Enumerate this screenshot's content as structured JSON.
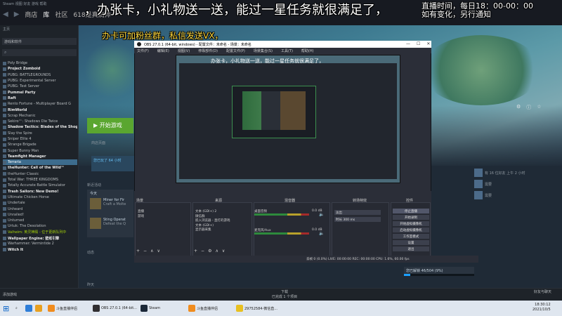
{
  "steam": {
    "menu": "Steam  视图  好友  游戏  帮助",
    "nav": {
      "store": "商店",
      "library": "库",
      "community": "社区",
      "user": "618是真滴帅"
    },
    "home": "主页",
    "filter": "游戏和软件",
    "games": [
      {
        "name": "Poly Bridge",
        "style": ""
      },
      {
        "name": "Project Zomboid",
        "style": "bright"
      },
      {
        "name": "PUBG: BATTLEGROUNDS",
        "style": ""
      },
      {
        "name": "PUBG: Experimental Server",
        "style": ""
      },
      {
        "name": "PUBG: Test Server",
        "style": ""
      },
      {
        "name": "Pummel Party",
        "style": "bright"
      },
      {
        "name": "Raft",
        "style": "bright"
      },
      {
        "name": "Rento Fortune - Multiplayer Board G",
        "style": ""
      },
      {
        "name": "RimWorld",
        "style": "bright"
      },
      {
        "name": "Scrap Mechanic",
        "style": ""
      },
      {
        "name": "Sekiro™: Shadows Die Twice",
        "style": ""
      },
      {
        "name": "Shadow Tactics: Blades of the Shog",
        "style": "bright"
      },
      {
        "name": "Slay the Spire",
        "style": ""
      },
      {
        "name": "Sniper Elite 4",
        "style": ""
      },
      {
        "name": "Strange Brigade",
        "style": ""
      },
      {
        "name": "Super Bunny Man",
        "style": ""
      },
      {
        "name": "Teamfight Manager",
        "style": "bright"
      },
      {
        "name": "Terraria",
        "style": "sel"
      },
      {
        "name": "theHunter: Call of the Wild™",
        "style": "bright"
      },
      {
        "name": "theHunter Classic",
        "style": ""
      },
      {
        "name": "Total War: THREE KINGDOMS",
        "style": ""
      },
      {
        "name": "Totally Accurate Battle Simulator",
        "style": ""
      },
      {
        "name": "Trash Sailors: New Demo!",
        "style": "bright"
      },
      {
        "name": "Ultimate Chicken Horse",
        "style": ""
      },
      {
        "name": "Undertale",
        "style": ""
      },
      {
        "name": "Unheard",
        "style": ""
      },
      {
        "name": "Unrailed!",
        "style": ""
      },
      {
        "name": "Unturned",
        "style": ""
      },
      {
        "name": "Urtuk: The Desolation",
        "style": ""
      },
      {
        "name": "Valheim: 英灵神殿 - 位于更新队列中",
        "style": "green"
      },
      {
        "name": "Wallpaper Engine: 壁纸引擎",
        "style": "bright"
      },
      {
        "name": "Warhammer: Vermintide 2",
        "style": ""
      },
      {
        "name": "Witch It",
        "style": "bright"
      }
    ],
    "add_game": "添加游戏",
    "play": "▶ 开始游戏",
    "store_page": "商店页面",
    "playtime": "您已玩了 64 小时",
    "activity_header": "新近活动",
    "today": "今天",
    "achievements": [
      {
        "title": "Miner for Fir",
        "desc": "Craft a Molte"
      },
      {
        "title": "Sting Operat",
        "desc": "Defeat the Q"
      }
    ],
    "activity2": "动态",
    "activity3": "昨天",
    "achv_progress": "您已解锁 46/504 (9%)",
    "achv_fraction": 0.09,
    "downloads": "下载",
    "downloads_sub": "已完成 1 个项目",
    "friends_chat": "好友与聊天",
    "friends": [
      {
        "text": "有 16 位好友 上午 2 小时"
      },
      {
        "text": "需要"
      },
      {
        "text": "需要"
      }
    ]
  },
  "overlay": {
    "main": "，办张卡，小礼物送一送，能过一星任务就很满足了，",
    "right1": "直播时间，每日18：00-00：00",
    "right2": "如有变化，另行通知",
    "sub": "办卡可加粉丝群，私信发送VX，"
  },
  "obs": {
    "title": "OBS 27.0.1 (64-bit, windows) - 配置文件：未命名 - 场景：未命名",
    "menu": [
      "文件(F)",
      "编辑(E)",
      "视图(V)",
      "停靠部件(D)",
      "配置文件(P)",
      "场景集合(S)",
      "工具(T)",
      "帮助(H)"
    ],
    "preview_text": "办张卡，小礼物送一送，能过一星任务就很满足了，",
    "scenes_h": "场景",
    "scenes": [
      "直播",
      "游戏"
    ],
    "sources_h": "来源",
    "sources": [
      "文本 (GDI+) 2",
      "微信群",
      "嵌入浏览器 - 直打的游戏",
      "文本 (GDI+)",
      "显示器采集"
    ],
    "mixer_h": "混音器",
    "mixer": [
      {
        "name": "桌面音频",
        "db": "0.0 dB"
      },
      {
        "name": "麦克风/Aux",
        "db": "0.0 dB"
      }
    ],
    "trans_h": "转场特效",
    "trans": "淡出",
    "duration": "时长  300 ms",
    "ctrl_h": "控件",
    "controls": [
      "停止直播",
      "开始录制",
      "开始虚拟摄像机",
      "启动虚拟摄像机",
      "工作室模式",
      "设置",
      "退出"
    ],
    "status": "丢帧 0 (0.0%)   LIVE: 00:00:00   REC: 00:00:00   CPU: 1.6%, 60.00 fps"
  },
  "taskbar": {
    "items": [
      "斗鱼直播伴侣",
      "OBS 27.0.1 (64-bit...",
      "Steam",
      "斗鱼直播伴侣",
      "29752584-微信直..."
    ],
    "time": "18:30:12",
    "date": "2021/10/5"
  },
  "colors": {
    "accent": "#1a9fff",
    "play": "#5aa630",
    "obs_bg": "#2b2e38"
  }
}
